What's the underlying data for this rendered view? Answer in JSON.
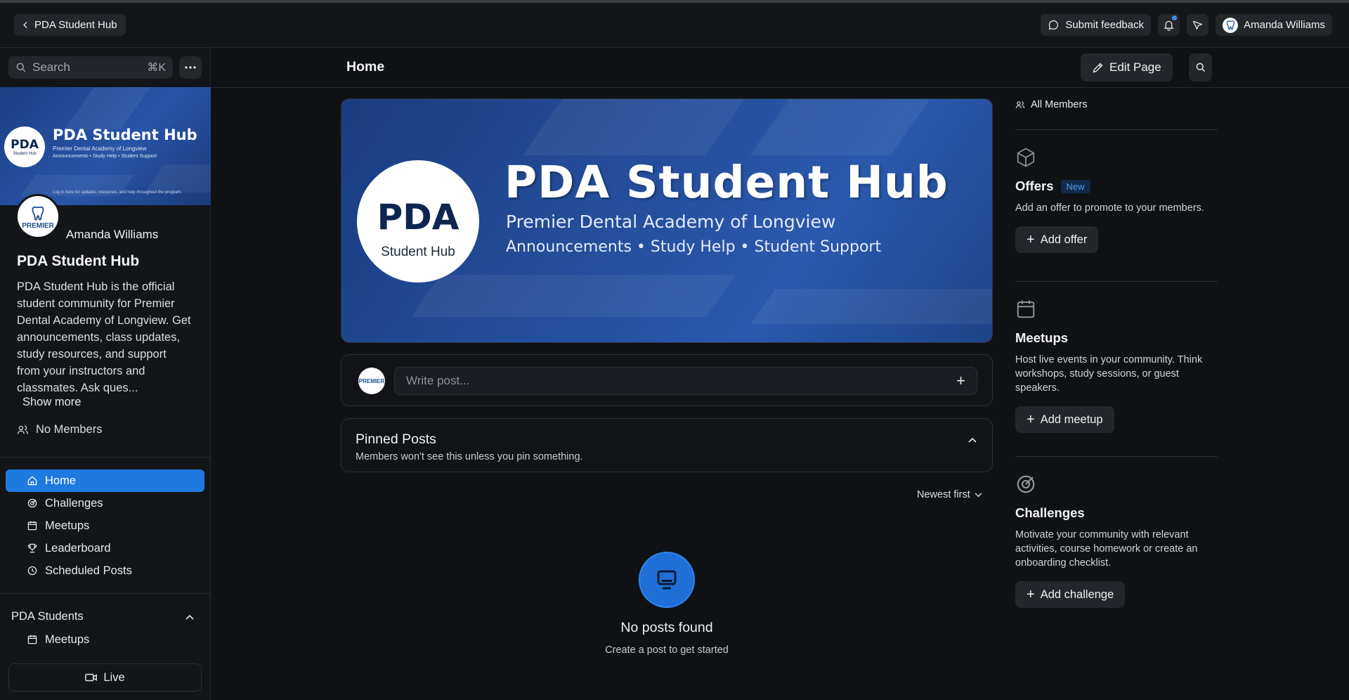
{
  "topbar": {
    "back_label": "PDA Student Hub",
    "feedback_label": "Submit feedback",
    "user_name": "Amanda Williams"
  },
  "sidebar": {
    "search_placeholder": "Search",
    "search_shortcut": "⌘K",
    "banner": {
      "title": "PDA Student Hub",
      "subtitle": "Premier Dental Academy of Longview",
      "tagline": "Announcements • Study Help • Student Support",
      "footer": "Log in here for updates, resources, and help throughout the program.",
      "circle_main": "PDA",
      "circle_sub": "Student Hub"
    },
    "avatar_text": "PREMIER",
    "profile_name": "Amanda Williams",
    "hub_title": "PDA Student Hub",
    "hub_description": "PDA Student Hub is the official student community for Premier Dental Academy of Longview. Get announcements, class updates, study resources, and support from your instructors and classmates. Ask ques...",
    "show_more": "Show more",
    "members_label": "No Members",
    "nav": [
      {
        "label": "Home",
        "icon": "home-icon",
        "active": true
      },
      {
        "label": "Challenges",
        "icon": "target-icon"
      },
      {
        "label": "Meetups",
        "icon": "calendar-icon"
      },
      {
        "label": "Leaderboard",
        "icon": "trophy-icon"
      },
      {
        "label": "Scheduled Posts",
        "icon": "clock-icon"
      }
    ],
    "section": {
      "title": "PDA Students",
      "items": [
        {
          "label": "Meetups",
          "icon": "calendar-icon"
        }
      ]
    },
    "live_label": "Live"
  },
  "main": {
    "page_title": "Home",
    "edit_label": "Edit Page",
    "hero": {
      "circle_main": "PDA",
      "circle_sub": "Student Hub",
      "title": "PDA Student Hub",
      "subtitle": "Premier Dental Academy of Longview",
      "tagline": "Announcements • Study Help • Student Support"
    },
    "write_placeholder": "Write post...",
    "write_avatar_text": "PREMIER",
    "pinned": {
      "title": "Pinned Posts",
      "subtitle": "Members won't see this unless you pin something."
    },
    "sort_label": "Newest first",
    "empty": {
      "title": "No posts found",
      "subtitle": "Create a post to get started"
    }
  },
  "rail": {
    "all_members": "All Members",
    "offers": {
      "title": "Offers",
      "badge": "New",
      "description": "Add an offer to promote to your members.",
      "button": "Add offer"
    },
    "meetups": {
      "title": "Meetups",
      "description": "Host live events in your community. Think workshops, study sessions, or guest speakers.",
      "button": "Add meetup"
    },
    "challenges": {
      "title": "Challenges",
      "description": "Motivate your community with relevant activities, course homework or create an onboarding checklist.",
      "button": "Add challenge"
    }
  },
  "colors": {
    "accent": "#1f7ae0",
    "background": "#0f1114",
    "panel": "#131518",
    "badge_text": "#4d9ef2"
  }
}
